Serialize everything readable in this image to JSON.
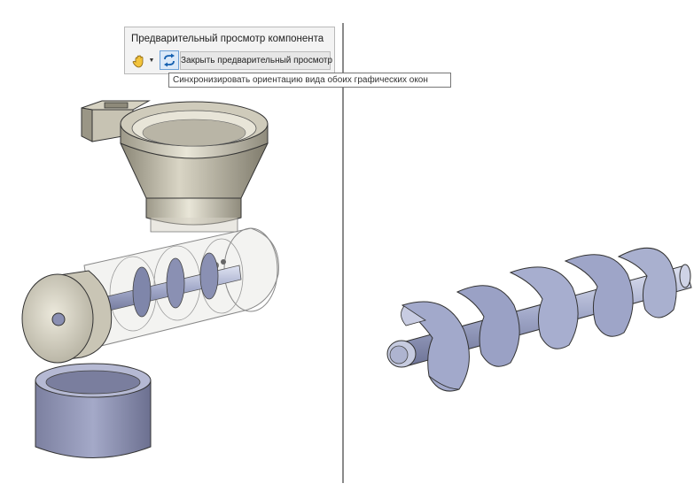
{
  "preview_panel": {
    "title": "Предварительный просмотр компонента",
    "close_label": "Закрыть предварительный просмотр",
    "hand_icon": "hand-pan-icon",
    "sync_icon": "sync-orientation-icon"
  },
  "tooltip": {
    "text": "Синхронизировать ориентацию вида обоих графических окон"
  },
  "colors": {
    "panel_bg": "#f3f3f3",
    "sync_button_border": "#6b9fd6",
    "sync_button_bg": "#dbe9f8",
    "model_beige": "#d8d4c4",
    "screw_blue": "#a9b0cf"
  }
}
